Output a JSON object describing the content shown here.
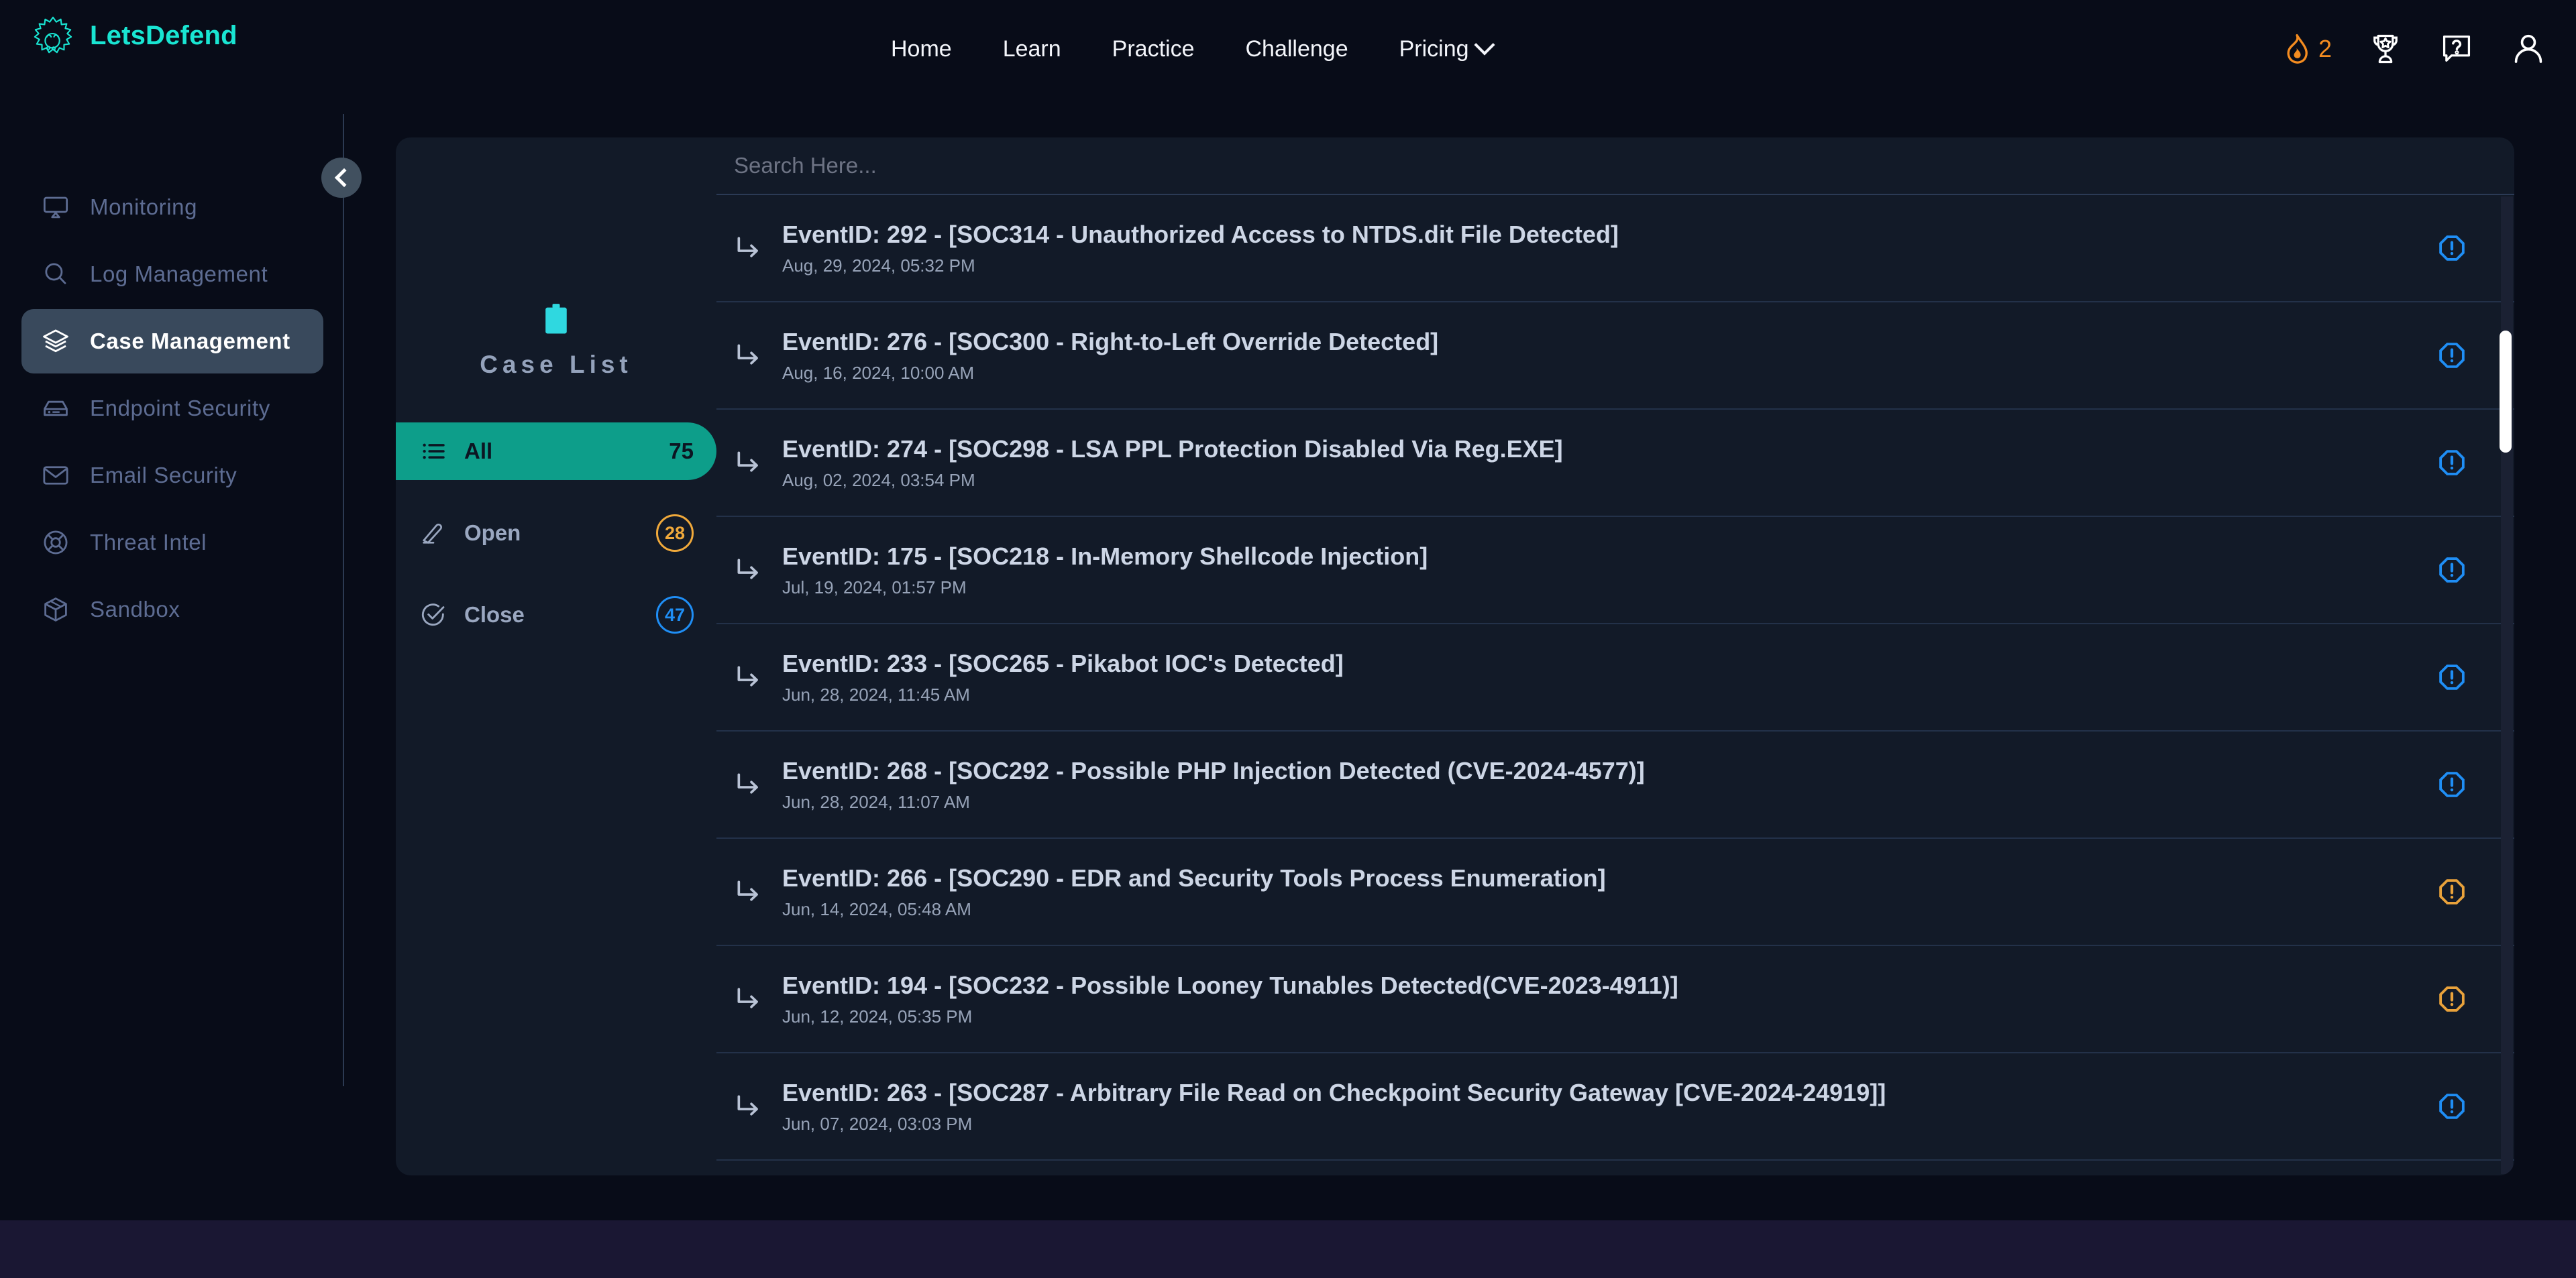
{
  "brand": {
    "name": "LetsDefend",
    "logo_icon": "letsdefend-starburst-logo",
    "accent": "#19e5d2"
  },
  "topnav": {
    "links": [
      {
        "label": "Home",
        "icon": null
      },
      {
        "label": "Learn",
        "icon": null
      },
      {
        "label": "Practice",
        "icon": null
      },
      {
        "label": "Challenge",
        "icon": null
      },
      {
        "label": "Pricing",
        "icon": "chevron-down-icon"
      }
    ],
    "right": {
      "streak_icon": "flame-icon",
      "streak_count": "2",
      "streak_color": "#f48c20",
      "trophy_icon": "trophy-star-icon",
      "help_icon": "question-speech-bubble-icon",
      "account_icon": "user-avatar-icon"
    }
  },
  "sidebar": {
    "collapse_icon": "chevron-left-icon",
    "items": [
      {
        "label": "Monitoring",
        "icon": "monitor-screen-icon",
        "active": false
      },
      {
        "label": "Log Management",
        "icon": "magnifier-search-icon",
        "active": false
      },
      {
        "label": "Case Management",
        "icon": "layers-stack-icon",
        "active": true
      },
      {
        "label": "Endpoint Security",
        "icon": "server-device-icon",
        "active": false
      },
      {
        "label": "Email Security",
        "icon": "envelope-mail-icon",
        "active": false
      },
      {
        "label": "Threat Intel",
        "icon": "lifebuoy-target-icon",
        "active": false
      },
      {
        "label": "Sandbox",
        "icon": "cube-box-icon",
        "active": false
      }
    ]
  },
  "caselist": {
    "header_icon": "clipboard-icon",
    "title": "Case List",
    "filters": [
      {
        "label": "All",
        "count": "75",
        "icon": "list-bullets-icon",
        "active": true,
        "badge_style": "plain"
      },
      {
        "label": "Open",
        "count": "28",
        "icon": "pencil-edit-icon",
        "active": false,
        "badge_style": "open",
        "badge_color": "#f0a93b"
      },
      {
        "label": "Close",
        "count": "47",
        "icon": "check-circle-icon",
        "active": false,
        "badge_style": "close",
        "badge_color": "#1f8ef5"
      }
    ]
  },
  "search": {
    "placeholder": "Search Here...",
    "value": ""
  },
  "cases": [
    {
      "title": "EventID: 292 - [SOC314 - Unauthorized Access to NTDS.dit File Detected]",
      "date": "Aug, 29, 2024, 05:32 PM",
      "severity_icon": "octagon-alert-icon",
      "severity_color": "#1f8ef5"
    },
    {
      "title": "EventID: 276 - [SOC300 - Right-to-Left Override Detected]",
      "date": "Aug, 16, 2024, 10:00 AM",
      "severity_icon": "octagon-alert-icon",
      "severity_color": "#1f8ef5"
    },
    {
      "title": "EventID: 274 - [SOC298 - LSA PPL Protection Disabled Via Reg.EXE]",
      "date": "Aug, 02, 2024, 03:54 PM",
      "severity_icon": "octagon-alert-icon",
      "severity_color": "#1f8ef5"
    },
    {
      "title": "EventID: 175 - [SOC218 - In-Memory Shellcode Injection]",
      "date": "Jul, 19, 2024, 01:57 PM",
      "severity_icon": "octagon-alert-icon",
      "severity_color": "#1f8ef5"
    },
    {
      "title": "EventID: 233 - [SOC265 - Pikabot IOC's Detected]",
      "date": "Jun, 28, 2024, 11:45 AM",
      "severity_icon": "octagon-alert-icon",
      "severity_color": "#1f8ef5"
    },
    {
      "title": "EventID: 268 - [SOC292 - Possible PHP Injection Detected (CVE-2024-4577)]",
      "date": "Jun, 28, 2024, 11:07 AM",
      "severity_icon": "octagon-alert-icon",
      "severity_color": "#1f8ef5"
    },
    {
      "title": "EventID: 266 - [SOC290 - EDR and Security Tools Process Enumeration]",
      "date": "Jun, 14, 2024, 05:48 AM",
      "severity_icon": "octagon-alert-icon",
      "severity_color": "#e9a23b"
    },
    {
      "title": "EventID: 194 - [SOC232 - Possible Looney Tunables Detected(CVE-2023-4911)]",
      "date": "Jun, 12, 2024, 05:35 PM",
      "severity_icon": "octagon-alert-icon",
      "severity_color": "#e9a23b"
    },
    {
      "title": "EventID: 263 - [SOC287 - Arbitrary File Read on Checkpoint Security Gateway [CVE-2024-24919]]",
      "date": "Jun, 07, 2024, 03:03 PM",
      "severity_icon": "octagon-alert-icon",
      "severity_color": "#1f8ef5"
    }
  ],
  "scrollbar": {
    "orientation": "vertical",
    "thumb_color": "#ffffff"
  }
}
